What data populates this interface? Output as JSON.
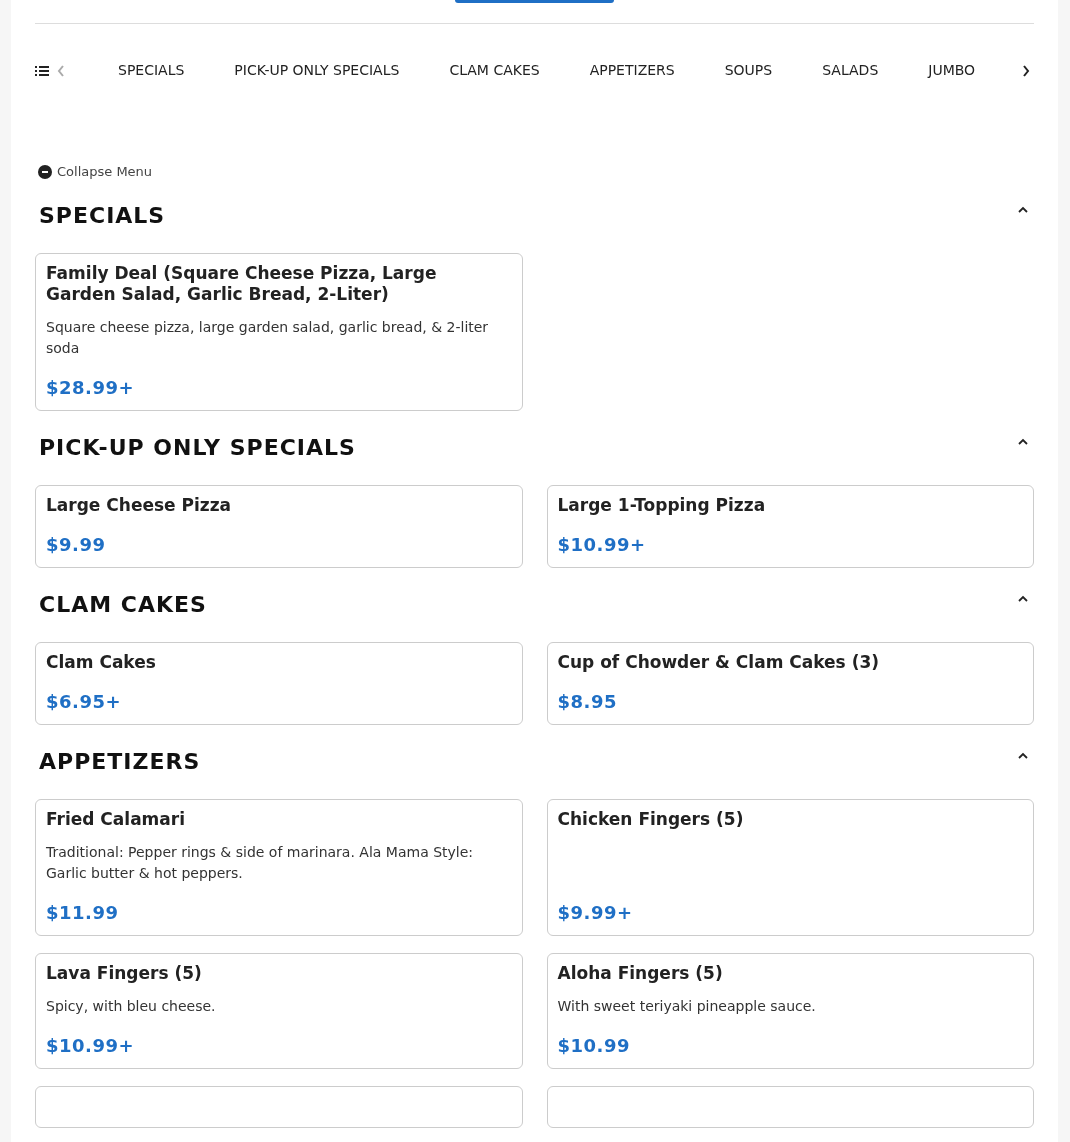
{
  "category_tabs": [
    {
      "label": "SPECIALS",
      "selected": false
    },
    {
      "label": "PICK-UP ONLY SPECIALS",
      "selected": false
    },
    {
      "label": "CLAM CAKES",
      "selected": false
    },
    {
      "label": "APPETIZERS",
      "selected": false
    },
    {
      "label": "SOUPS",
      "selected": false
    },
    {
      "label": "SALADS",
      "selected": false
    },
    {
      "label": "JUMBO",
      "selected": false
    }
  ],
  "collapse_link": "Collapse Menu",
  "sections": [
    {
      "title": "SPECIALS",
      "expanded": true,
      "items": [
        {
          "name": "Family Deal (Square Cheese Pizza, Large Garden Salad, Garlic Bread, 2-Liter)",
          "description": "Square cheese pizza, large garden salad, garlic bread, & 2-liter soda",
          "price": "$28.99+"
        }
      ]
    },
    {
      "title": "PICK-UP ONLY SPECIALS",
      "expanded": true,
      "items": [
        {
          "name": "Large Cheese Pizza",
          "price": "$9.99"
        },
        {
          "name": "Large 1-Topping Pizza",
          "price": "$10.99+"
        }
      ]
    },
    {
      "title": "CLAM CAKES",
      "expanded": true,
      "items": [
        {
          "name": "Clam Cakes",
          "price": "$6.95+"
        },
        {
          "name": "Cup of Chowder & Clam Cakes (3)",
          "price": "$8.95"
        }
      ]
    },
    {
      "title": "APPETIZERS",
      "expanded": true,
      "items": [
        {
          "name": "Fried Calamari",
          "description": "Traditional: Pepper rings & side of marinara. Ala Mama Style: Garlic butter & hot peppers.",
          "price": "$11.99"
        },
        {
          "name": "Chicken Fingers (5)",
          "price": "$9.99+"
        },
        {
          "name": "Lava Fingers (5)",
          "description": "Spicy, with bleu cheese.",
          "price": "$10.99+"
        },
        {
          "name": "Aloha Fingers (5)",
          "description": "With sweet teriyaki pineapple sauce.",
          "price": "$10.99"
        },
        {
          "kind": "partial"
        },
        {
          "kind": "partial"
        }
      ]
    }
  ]
}
